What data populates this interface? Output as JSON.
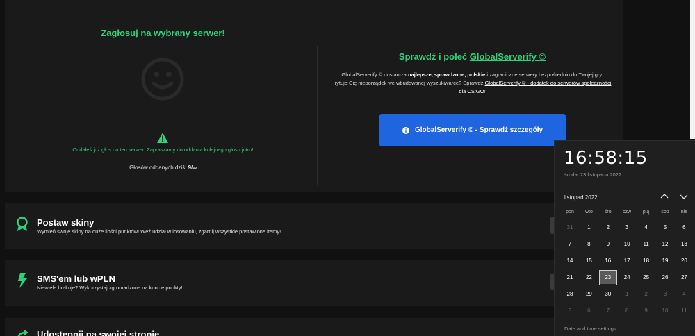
{
  "vote": {
    "title": "Zagłosuj na wybrany serwer!",
    "message": "Oddałeś już głos na ten serwer. Zapraszamy do oddania kolejnego głosu jutro!",
    "count_label": "Głosów oddanych dziś:",
    "count_value": "9/∞"
  },
  "globalserverify": {
    "title_prefix": "Sprawdź i poleć",
    "title_link": "GlobalServerify ©",
    "desc_a": "GlobalServerify © dostarcza",
    "desc_bold": "najlepsze, sprawdzone, polskie",
    "desc_b": "i zagraniczne serwery bezpośrednio do Twojej gry.",
    "desc_c": "Irytuje Cię nieporządek we wbudowanej wyszukiwarce? Sprawdź",
    "desc_link": "GlobalServerify © - dodatek do serwerów społeczności dla CS:GO",
    "desc_end": "!",
    "button_label": "GlobalServerify © - Sprawdź szczegóły"
  },
  "rows": [
    {
      "title": "Postaw skiny",
      "desc": "Wymień swoje skiny na duże ilości punktów! Weź udział w losowaniu, zgarnij wszystkie postawione itemy!"
    },
    {
      "title": "SMS'em lub wPLN",
      "desc": "Niewiele brakuje? Wykorzystaj zgromadzone na koncie punkty!"
    },
    {
      "title": "Udostępnij na swojej stronie",
      "desc": ""
    }
  ],
  "colors": {
    "accent_green": "#2ed17a",
    "button_blue": "#2065e0",
    "card_bg": "#1a1a1a"
  },
  "icons": [
    "smiley-icon",
    "warning-icon",
    "info-icon",
    "award-icon",
    "bolt-icon",
    "share-icon",
    "chevron-up-icon",
    "chevron-down-icon"
  ],
  "clock": {
    "time": "16:58:15",
    "date": "środa, 23 listopada 2022",
    "month_label": "listopad 2022",
    "weekdays": [
      "pon",
      "wto",
      "śro",
      "czw",
      "pią",
      "sob",
      "nie"
    ],
    "weeks": [
      [
        "31",
        "1",
        "2",
        "3",
        "4",
        "5",
        "6"
      ],
      [
        "7",
        "8",
        "9",
        "10",
        "11",
        "12",
        "13"
      ],
      [
        "14",
        "15",
        "16",
        "17",
        "18",
        "19",
        "20"
      ],
      [
        "21",
        "22",
        "23",
        "24",
        "25",
        "26",
        "27"
      ],
      [
        "28",
        "29",
        "30",
        "1",
        "2",
        "3",
        "4"
      ],
      [
        "5",
        "6",
        "7",
        "8",
        "9",
        "10",
        "11"
      ]
    ],
    "today": "23",
    "settings_label": "Date and time settings"
  }
}
